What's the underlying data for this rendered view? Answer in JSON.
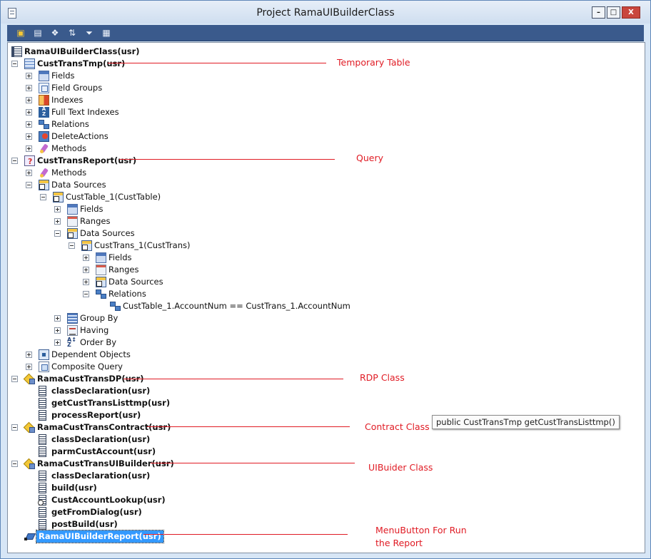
{
  "window": {
    "title": "Project RamaUIBuilderClass",
    "minimize": "–",
    "restore": "□",
    "close": "X"
  },
  "toolbar": {
    "icons": [
      "open-folder-icon",
      "properties-icon",
      "compile-icon",
      "sort-icon",
      "filter-icon",
      "calendar-icon"
    ]
  },
  "tree": {
    "root": "RamaUIBuilderClass(usr)",
    "custtranstmp": {
      "label": "CustTransTmp(usr)",
      "children": [
        "Fields",
        "Field Groups",
        "Indexes",
        "Full Text Indexes",
        "Relations",
        "DeleteActions",
        "Methods"
      ]
    },
    "custtransreport": {
      "label": "CustTransReport(usr)",
      "methods": "Methods",
      "data_sources": "Data Sources",
      "custtable": "CustTable_1(CustTable)",
      "ct_fields": "Fields",
      "ct_ranges": "Ranges",
      "ct_data_sources": "Data Sources",
      "custtrans": "CustTrans_1(CustTrans)",
      "tr_fields": "Fields",
      "tr_ranges": "Ranges",
      "tr_data_sources": "Data Sources",
      "tr_relations": "Relations",
      "relation_expr": "CustTable_1.AccountNum == CustTrans_1.AccountNum",
      "group_by": "Group By",
      "having": "Having",
      "order_by": "Order By",
      "dependent_objects": "Dependent Objects",
      "composite_query": "Composite Query"
    },
    "dp": {
      "label": "RamaCustTransDP(usr)",
      "methods": [
        "classDeclaration(usr)",
        "getCustTransListtmp(usr)",
        "processReport(usr)"
      ]
    },
    "contract": {
      "label": "RamaCustTransContract(usr)",
      "methods": [
        "classDeclaration(usr)",
        "parmCustAccount(usr)"
      ]
    },
    "uibuilder": {
      "label": "RamaCustTransUIBuilder(usr)",
      "methods": [
        "classDeclaration(usr)",
        "build(usr)",
        "CustAccountLookup(usr)",
        "getFromDialog(usr)",
        "postBuild(usr)"
      ]
    },
    "menu": {
      "label": "RamaUIBuilderReport(usr)"
    }
  },
  "annotations": {
    "temporary_table": "Temporary Table",
    "query": "Query",
    "rdp_class": "RDP Class",
    "contract_class": "Contract Class",
    "uibuider_class": "UIBuider Class",
    "menubutton_line1": "MenuButton For Run",
    "menubutton_line2": "the Report",
    "color": "#e01b24"
  },
  "tooltip": "public CustTransTmp getCustTransListtmp()"
}
